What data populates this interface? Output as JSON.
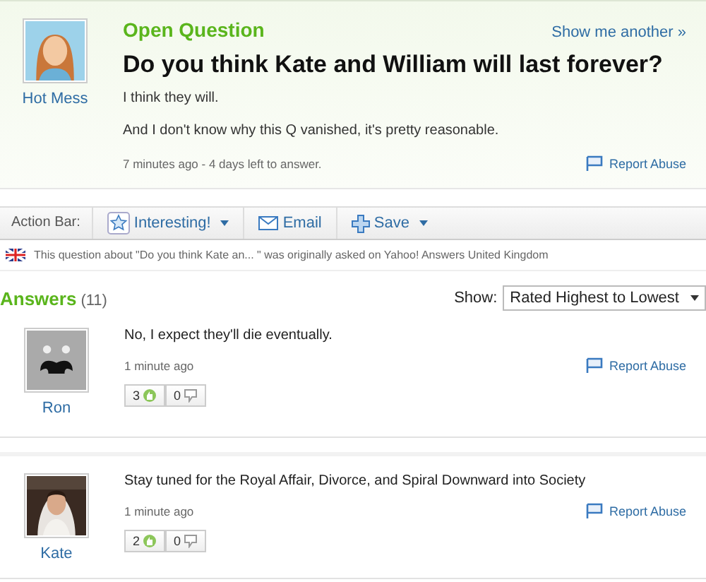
{
  "question": {
    "status": "Open Question",
    "show_another": "Show me another »",
    "author": "Hot Mess",
    "title": "Do you think Kate and William will last forever?",
    "paragraphs": [
      "I think they will.",
      "And I don't know why this Q vanished, it's pretty reasonable."
    ],
    "meta": "7 minutes ago - 4 days left to answer.",
    "report": "Report Abuse"
  },
  "action_bar": {
    "label": "Action Bar:",
    "buttons": [
      {
        "kind": "star",
        "label": "Interesting!",
        "dropdown": true
      },
      {
        "kind": "mail",
        "label": "Email",
        "dropdown": false
      },
      {
        "kind": "plus",
        "label": "Save",
        "dropdown": true
      }
    ]
  },
  "notice": "This question about \"Do you think Kate an... \" was originally asked on Yahoo! Answers United Kingdom",
  "answers_header": {
    "title": "Answers",
    "count": "(11)",
    "show_label": "Show:",
    "sort": "Rated Highest to Lowest"
  },
  "answers": [
    {
      "author": "Ron",
      "kind": "mustache",
      "text": "No, I expect they'll die eventually.",
      "time": "1 minute ago",
      "report": "Report Abuse",
      "up": "3",
      "down": "0"
    },
    {
      "author": "Kate",
      "kind": "picture",
      "text": "Stay tuned for the Royal Affair, Divorce, and Spiral Downward into Society",
      "time": "1 minute ago",
      "report": "Report Abuse",
      "up": "2",
      "down": "0"
    }
  ]
}
